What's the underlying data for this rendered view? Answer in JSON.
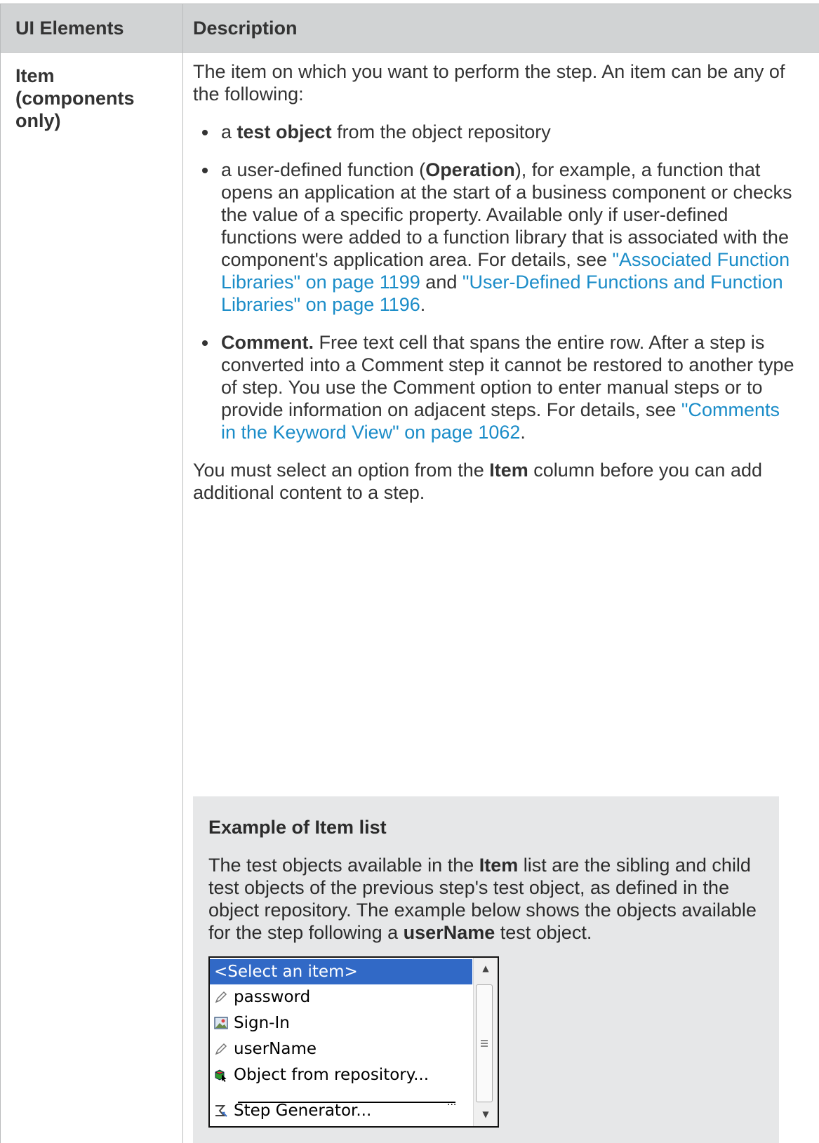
{
  "table": {
    "headers": [
      "UI Elements",
      "Description"
    ],
    "row": {
      "element": "Item (components only)",
      "intro": "The item on which you want to perform the step. An item can be any of the following:",
      "bullets": [
        {
          "pre": "a ",
          "bold": "test object",
          "post": " from the object repository"
        },
        {
          "pre": "a user-defined function (",
          "bold": "Operation",
          "post": "), for example, a function that opens an application at the start of a business component or checks the value of a specific property. Available only if user-defined functions were added to a function library that is associated with the component's application area. For details, see ",
          "link1": "\"Associated Function Libraries\" on page 1199",
          "mid": " and ",
          "link2": "\"User-Defined Functions and Function Libraries\" on page 1196",
          "end": "."
        },
        {
          "bold": "Comment.",
          "post": " Free text cell that spans the entire row. After a step is converted into a Comment step it cannot be restored to another type of step. You use the Comment option to enter manual steps or to provide information on adjacent steps. For details, see ",
          "link1": "\"Comments in the Keyword View\" on page 1062",
          "end": "."
        }
      ],
      "note_pre": "You must select an option from the ",
      "note_bold": "Item",
      "note_post": " column before you can add additional content to a step.",
      "example": {
        "title": "Example of Item list",
        "text_pre": "The test objects available in the ",
        "text_bold": "Item",
        "text_mid": " list are the sibling and child test objects of the previous step's test object, as defined in the object repository. The example below shows the objects available for the step following a ",
        "text_bold2": "userName",
        "text_post": " test object.",
        "list": {
          "selected": "<Select an item>",
          "items": [
            {
              "label": "password",
              "icon": "pencil-icon"
            },
            {
              "label": "Sign-In",
              "icon": "image-icon"
            },
            {
              "label": "userName",
              "icon": "pencil-icon"
            },
            {
              "label": "Object from repository...",
              "icon": "cube-cursor-icon"
            },
            {
              "label": "Step Generator...",
              "icon": "step-generator-icon"
            }
          ]
        }
      }
    }
  },
  "colors": {
    "link": "#1a8cc8",
    "header_bg": "#d1d3d4",
    "example_bg": "#e6e7e8",
    "selection": "#3169c6"
  }
}
